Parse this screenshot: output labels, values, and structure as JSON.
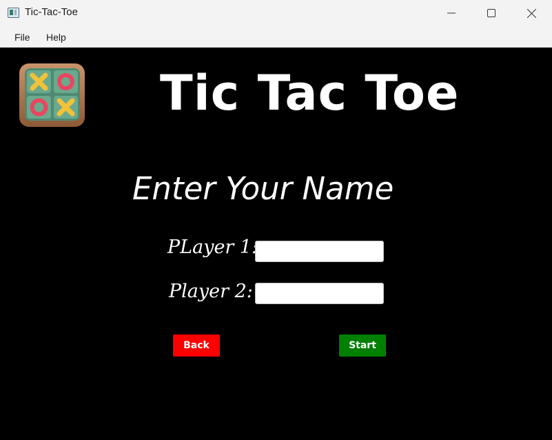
{
  "window": {
    "title": "Tic-Tac-Toe"
  },
  "menu": {
    "items": [
      {
        "label": "File"
      },
      {
        "label": "Help"
      }
    ]
  },
  "main": {
    "title": "Tic Tac Toe",
    "subtitle": "Enter Your Name",
    "player1": {
      "label": "PLayer 1:",
      "value": ""
    },
    "player2": {
      "label": "Player 2:",
      "value": ""
    },
    "back_label": "Back",
    "start_label": "Start"
  },
  "colors": {
    "background": "#000000",
    "back_button": "#ff0000",
    "start_button": "#008000",
    "logo_board": "#5e9c82",
    "logo_frame": "#b07a52",
    "logo_x": "#f2c23a",
    "logo_o": "#e8475f"
  },
  "icons": {
    "app": "tic-tac-toe-window-icon",
    "logo": "tic-tac-toe-board-icon",
    "minimize": "minimize-icon",
    "maximize": "maximize-icon",
    "close": "close-icon"
  }
}
